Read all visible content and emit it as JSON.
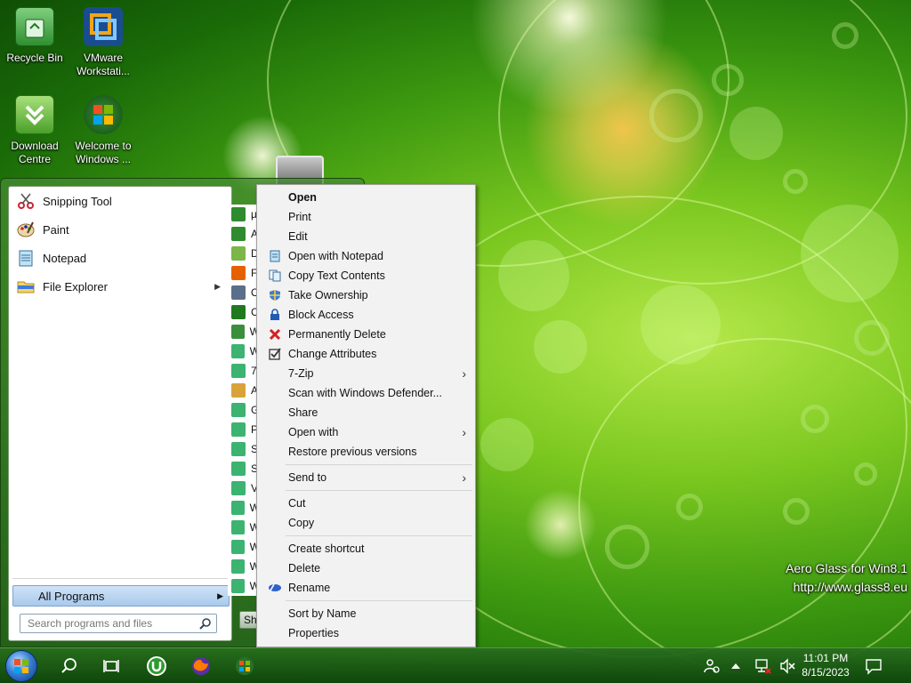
{
  "desktop": {
    "icons": [
      {
        "label": "Recycle Bin",
        "icon": "recycle-bin-icon"
      },
      {
        "label": "VMware Workstati...",
        "icon": "vmware-icon"
      },
      {
        "label": "Download Centre",
        "icon": "download-centre-icon"
      },
      {
        "label": "Welcome to Windows ...",
        "icon": "windows-logo-icon"
      }
    ],
    "watermark": {
      "line1": "Aero Glass for Win8.1",
      "line2": "http://www.glass8.eu"
    }
  },
  "start_menu": {
    "pinned": [
      {
        "label": "Snipping Tool",
        "icon": "scissors-icon"
      },
      {
        "label": "Paint",
        "icon": "palette-icon"
      },
      {
        "label": "Notepad",
        "icon": "notepad-icon"
      },
      {
        "label": "File Explorer",
        "icon": "folder-icon"
      }
    ],
    "all_programs": "All Programs",
    "search_placeholder": "Search programs and files",
    "shutdown_label": "Sh",
    "program_strip": [
      {
        "text": "µ",
        "color": "#2e8b2e"
      },
      {
        "text": "A",
        "color": "#2e8b2e"
      },
      {
        "text": "D",
        "color": "#7ab648"
      },
      {
        "text": "F",
        "color": "#e66000"
      },
      {
        "text": "O",
        "color": "#5a6f8a"
      },
      {
        "text": "C",
        "color": "#1f7a1f"
      },
      {
        "text": "W",
        "color": "#3b8e3b"
      },
      {
        "text": "W",
        "color": "#3cb371"
      },
      {
        "text": "7",
        "color": "#3cb371"
      },
      {
        "text": "A",
        "color": "#d9a33a"
      },
      {
        "text": "G",
        "color": "#3cb371"
      },
      {
        "text": "P",
        "color": "#3cb371"
      },
      {
        "text": "S",
        "color": "#3cb371"
      },
      {
        "text": "S",
        "color": "#3cb371"
      },
      {
        "text": "V",
        "color": "#3cb371"
      },
      {
        "text": "W",
        "color": "#3cb371"
      },
      {
        "text": "W",
        "color": "#3cb371"
      },
      {
        "text": "W",
        "color": "#3cb371"
      },
      {
        "text": "W",
        "color": "#3cb371"
      },
      {
        "text": "W",
        "color": "#3cb371"
      }
    ]
  },
  "context_menu": {
    "items": [
      {
        "label": "Open",
        "bold": true
      },
      {
        "label": "Print"
      },
      {
        "label": "Edit"
      },
      {
        "label": "Open with Notepad",
        "icon": "notepad-icon"
      },
      {
        "label": "Copy Text Contents",
        "icon": "copy-text-icon"
      },
      {
        "label": "Take Ownership",
        "icon": "shield-icon"
      },
      {
        "label": "Block Access",
        "icon": "lock-icon"
      },
      {
        "label": "Permanently Delete",
        "icon": "red-x-icon"
      },
      {
        "label": "Change Attributes",
        "icon": "checkbox-icon"
      },
      {
        "label": "7-Zip",
        "submenu": true
      },
      {
        "label": "Scan with Windows Defender..."
      },
      {
        "label": "Share"
      },
      {
        "label": "Open with",
        "submenu": true
      },
      {
        "label": "Restore previous versions"
      },
      {
        "label": "Send to",
        "submenu": true
      },
      {
        "label": "Cut"
      },
      {
        "label": "Copy"
      },
      {
        "label": "Create shortcut"
      },
      {
        "label": "Delete"
      },
      {
        "label": "Rename",
        "icon": "rename-icon"
      },
      {
        "label": "Sort by Name"
      },
      {
        "label": "Properties"
      }
    ]
  },
  "taskbar": {
    "clock_time": "11:01 PM",
    "clock_date": "8/15/2023",
    "accent": "#1f6b12"
  }
}
